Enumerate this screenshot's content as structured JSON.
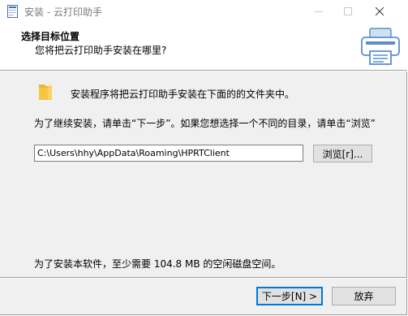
{
  "window": {
    "title": "安装 - 云打印助手",
    "app_icon": "installer-app-icon",
    "controls": [
      "minimize-icon",
      "maximize-icon",
      "close-icon"
    ]
  },
  "header": {
    "title": "选择目标位置",
    "subtitle": "您将把云打印助手安装在哪里?",
    "icon": "printer-icon"
  },
  "body": {
    "folder_icon": "folder-icon",
    "intro": "安装程序将把云打印助手安装在下面的的文件夹中。",
    "instruction": "为了继续安装，请单击“下一步”。如果您想选择一个不同的目录，请单击“浏览”",
    "path_value": "C:\\Users\\hhy\\AppData\\Roaming\\HPRTClient",
    "browse_label": "浏览[r]...",
    "space_required": "为了安装本软件，至少需要 104.8 MB 的空闲磁盘空间。"
  },
  "footer": {
    "next_label": "下一步[N] >",
    "cancel_label": "放弃"
  },
  "colors": {
    "focus_border": "#0078d7",
    "window_bg": "#f0f0f0",
    "folder": "#f5c542"
  }
}
